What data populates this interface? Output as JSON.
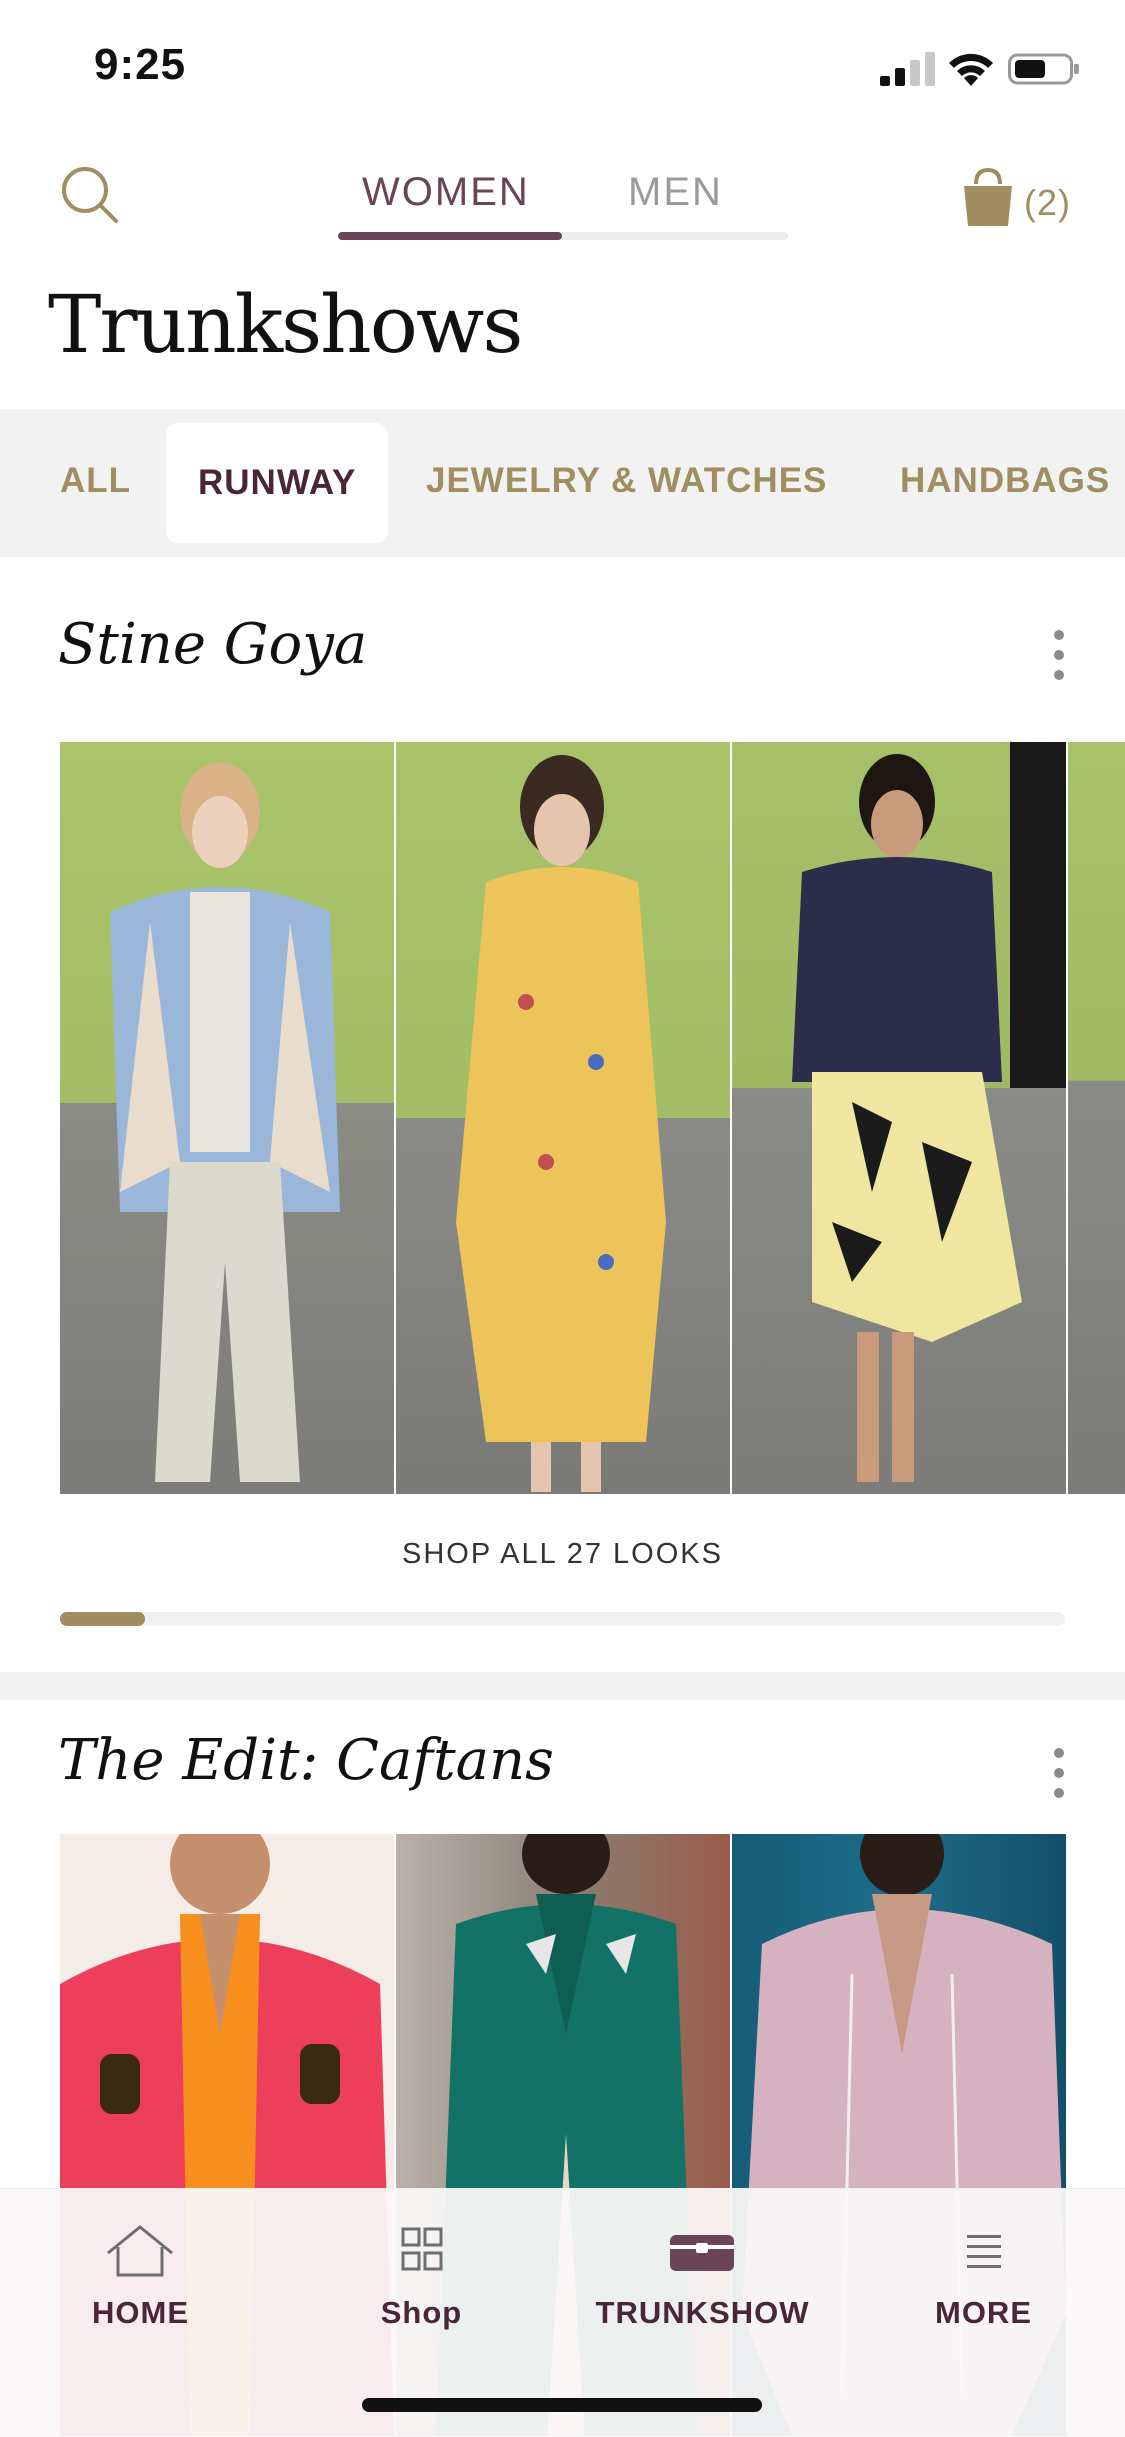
{
  "status_bar": {
    "time": "9:25"
  },
  "header": {
    "gender_tabs": [
      {
        "label": "WOMEN",
        "active": true
      },
      {
        "label": "MEN",
        "active": false
      }
    ],
    "cart_count": "(2)",
    "title": "Trunkshows"
  },
  "categories": [
    {
      "label": "ALL",
      "active": false
    },
    {
      "label": "RUNWAY",
      "active": true
    },
    {
      "label": "JEWELRY & WATCHES",
      "active": false
    },
    {
      "label": "HANDBAGS",
      "active": false
    }
  ],
  "sections": [
    {
      "title": "Stine Goya",
      "cta": "SHOP ALL 27 LOOKS",
      "carousel_progress": 0.085
    },
    {
      "title": "The Edit: Caftans"
    }
  ],
  "tabbar": {
    "items": [
      {
        "label": "HOME",
        "icon": "home-icon"
      },
      {
        "label": "Shop",
        "icon": "grid-icon"
      },
      {
        "label": "TRUNKSHOW",
        "icon": "trunk-icon"
      },
      {
        "label": "MORE",
        "icon": "menu-icon"
      }
    ]
  },
  "colors": {
    "accent_gold": "#a08d60",
    "accent_plum": "#4a2639",
    "tab_active": "#6a4558"
  }
}
